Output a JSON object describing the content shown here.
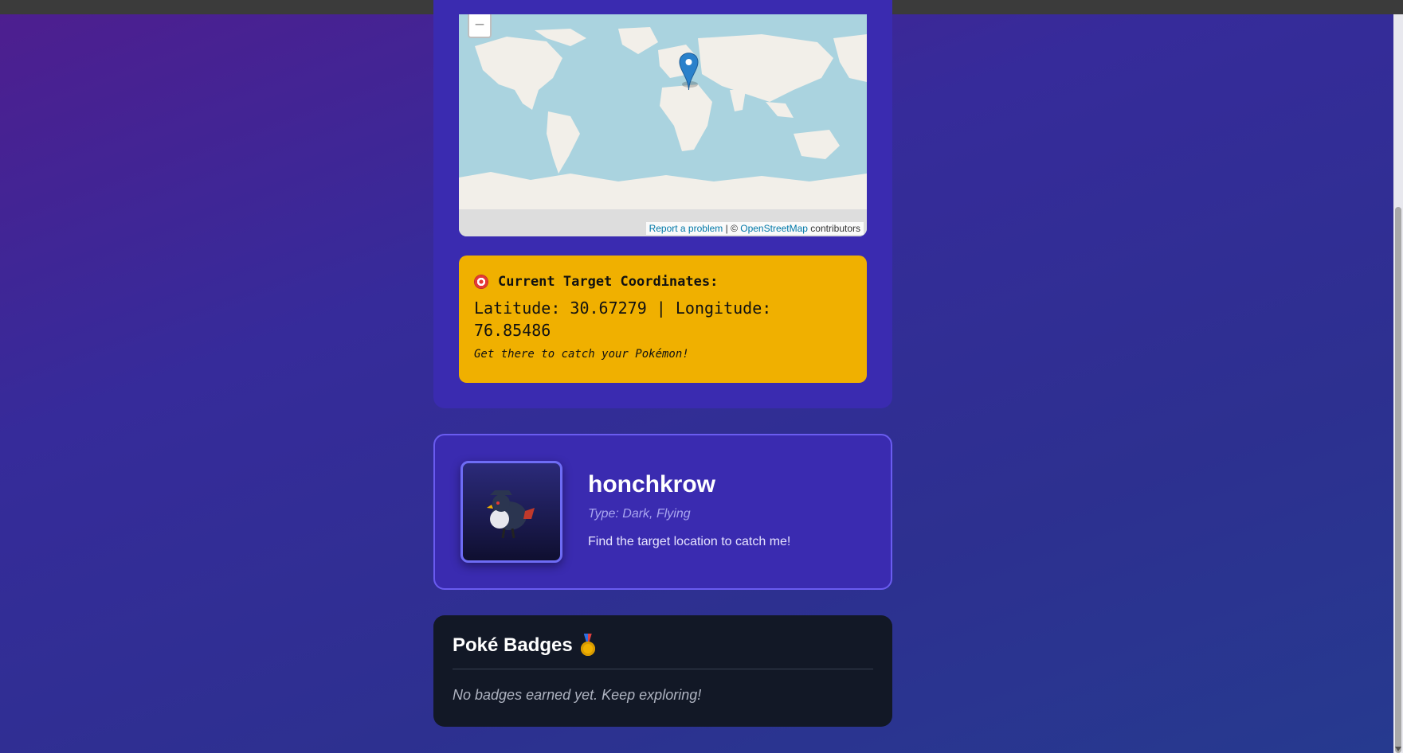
{
  "map": {
    "zoom_out_label": "−",
    "attribution": {
      "report_link": "Report a problem",
      "separator": " | © ",
      "osm_link": "OpenStreetMap",
      "suffix": " contributors"
    },
    "colors": {
      "water": "#aad3df",
      "land": "#f2efe9",
      "marker": "#2a81cb"
    }
  },
  "coordinates": {
    "title": "Current Target Coordinates:",
    "icon": "target-icon",
    "line": "Latitude: 30.67279 | Longitude: 76.85486",
    "hint": "Get there to catch your Pokémon!"
  },
  "pokemon": {
    "name": "honchkrow",
    "type": "Type: Dark, Flying",
    "message": "Find the target location to catch me!"
  },
  "badges": {
    "title": "Poké Badges",
    "icon": "medal-icon",
    "empty_text": "No badges earned yet. Keep exploring!"
  },
  "colors": {
    "accent_yellow": "#f0b000",
    "card_purple": "#3a2bb0",
    "dark_card": "#121826"
  }
}
